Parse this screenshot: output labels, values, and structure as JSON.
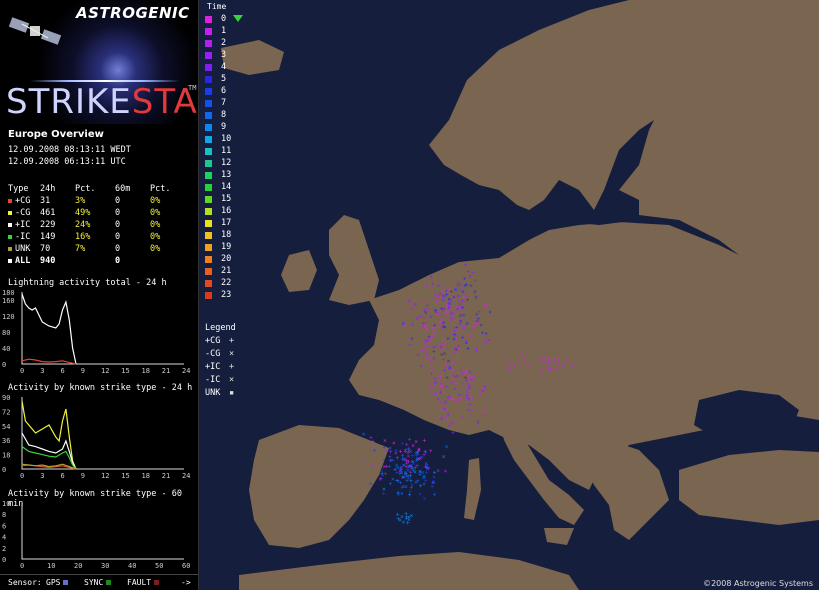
{
  "logo": {
    "brand": "ASTROGENIC",
    "title_a": "STRIKE",
    "title_b": "STAR",
    "tm": "TM"
  },
  "overview": {
    "title": "Europe Overview",
    "time_local": "12.09.2008 08:13:11 WEDT",
    "time_utc": "12.09.2008 06:13:11 UTC"
  },
  "stats": {
    "headers": [
      "Type",
      "24h",
      "Pct.",
      "60m",
      "Pct."
    ],
    "rows": [
      {
        "type": "+CG",
        "h24": "31",
        "pct24": "3%",
        "m60": "0",
        "pct60": "0%",
        "color": "#e04a2a"
      },
      {
        "type": "-CG",
        "h24": "461",
        "pct24": "49%",
        "m60": "0",
        "pct60": "0%",
        "color": "#f2f23a"
      },
      {
        "type": "+IC",
        "h24": "229",
        "pct24": "24%",
        "m60": "0",
        "pct60": "0%",
        "color": "#ffffff"
      },
      {
        "type": "-IC",
        "h24": "149",
        "pct24": "16%",
        "m60": "0",
        "pct60": "0%",
        "color": "#3ad23a"
      },
      {
        "type": "UNK",
        "h24": "70",
        "pct24": "7%",
        "m60": "0",
        "pct60": "0%",
        "color": "#b0a030"
      }
    ],
    "all": {
      "type": "ALL",
      "h24": "940",
      "m60": "0"
    }
  },
  "graphs": {
    "total_title": "Lightning activity total - 24 h",
    "type24_title": "Activity by known strike type - 24 h",
    "type60_title": "Activity by known strike type - 60 min"
  },
  "chart_data": [
    {
      "type": "line",
      "title": "Lightning activity total - 24 h",
      "ylim": [
        0,
        180
      ],
      "yticks": [
        "180",
        "160",
        "120",
        "80",
        "40",
        "0"
      ],
      "yticks_values": [
        180,
        160,
        120,
        80,
        40,
        0
      ],
      "xlim": [
        0,
        24
      ],
      "xticks": [
        "0",
        "3",
        "6",
        "9",
        "12",
        "15",
        "18",
        "21",
        "24"
      ],
      "series": [
        {
          "color": "#ffffff",
          "x": [
            0,
            0.5,
            1,
            1.5,
            2,
            3,
            4,
            5,
            5.5,
            6,
            6.5,
            7,
            7.5,
            8
          ],
          "y": [
            175,
            150,
            140,
            135,
            140,
            105,
            95,
            90,
            100,
            135,
            155,
            110,
            40,
            0
          ]
        },
        {
          "color": "#e04a2a",
          "x": [
            0,
            1,
            2,
            3,
            4,
            5,
            6,
            7,
            8
          ],
          "y": [
            8,
            12,
            10,
            6,
            5,
            6,
            8,
            4,
            0
          ]
        }
      ]
    },
    {
      "type": "line",
      "title": "Activity by known strike type - 24 h",
      "ylim": [
        0,
        90
      ],
      "yticks": [
        "90",
        "72",
        "54",
        "36",
        "18",
        "0"
      ],
      "yticks_values": [
        90,
        72,
        54,
        36,
        18,
        0
      ],
      "xlim": [
        0,
        24
      ],
      "xticks": [
        "0",
        "3",
        "6",
        "9",
        "12",
        "15",
        "18",
        "21",
        "24"
      ],
      "series": [
        {
          "color": "#f2f23a",
          "x": [
            0,
            0.5,
            1,
            2,
            3,
            4,
            5,
            5.5,
            6,
            6.5,
            7,
            7.5,
            8
          ],
          "y": [
            85,
            60,
            55,
            45,
            50,
            55,
            40,
            35,
            60,
            75,
            40,
            10,
            0
          ]
        },
        {
          "color": "#ffffff",
          "x": [
            0,
            1,
            2,
            3,
            4,
            5,
            6,
            6.5,
            7,
            7.5,
            8
          ],
          "y": [
            45,
            30,
            28,
            25,
            22,
            20,
            25,
            35,
            22,
            8,
            0
          ]
        },
        {
          "color": "#3ad23a",
          "x": [
            0,
            1,
            2,
            3,
            4,
            5,
            6,
            6.5,
            7,
            7.5,
            8
          ],
          "y": [
            28,
            22,
            20,
            18,
            16,
            15,
            20,
            22,
            14,
            5,
            0
          ]
        },
        {
          "color": "#e04a2a",
          "x": [
            0,
            1,
            2,
            3,
            4,
            5,
            6,
            7,
            8
          ],
          "y": [
            4,
            5,
            4,
            3,
            2,
            3,
            4,
            2,
            0
          ]
        },
        {
          "color": "#b0a030",
          "x": [
            0,
            1,
            2,
            3,
            4,
            5,
            6,
            7,
            8
          ],
          "y": [
            6,
            5,
            4,
            5,
            3,
            4,
            6,
            3,
            0
          ]
        }
      ]
    },
    {
      "type": "line",
      "title": "Activity by known strike type - 60 min",
      "ylim": [
        0,
        10
      ],
      "yticks": [
        "10",
        "8",
        "6",
        "4",
        "2",
        "0"
      ],
      "yticks_values": [
        10,
        8,
        6,
        4,
        2,
        0
      ],
      "xlim": [
        0,
        60
      ],
      "xticks": [
        "0",
        "10",
        "20",
        "30",
        "40",
        "50",
        "60"
      ],
      "series": []
    }
  ],
  "sensor": {
    "label": "Sensor:",
    "gps": "GPS",
    "sync": "SYNC",
    "fault": "FAULT",
    "arrow": "->",
    "gps_color": "#6a6ad0",
    "sync_color": "#1f8a1f",
    "fault_color": "#7a1f1f"
  },
  "legend": {
    "time_title": "Time",
    "time_colors": [
      "#e020e0",
      "#c820e8",
      "#b020ee",
      "#9820f0",
      "#8020f0",
      "#2828e0",
      "#1c3ce6",
      "#1650ea",
      "#1068ee",
      "#0c88f0",
      "#10a8e8",
      "#18c0c0",
      "#1cc890",
      "#20d060",
      "#28d03a",
      "#60d828",
      "#b0e020",
      "#e8e020",
      "#f0c020",
      "#f0a020",
      "#f08020",
      "#e86020",
      "#e04a20",
      "#d83a20"
    ],
    "time_labels": [
      "0",
      "1",
      "2",
      "3",
      "4",
      "5",
      "6",
      "7",
      "8",
      "9",
      "10",
      "11",
      "12",
      "13",
      "14",
      "15",
      "16",
      "17",
      "18",
      "19",
      "20",
      "21",
      "22",
      "23"
    ],
    "type_title": "Legend",
    "types": [
      {
        "label": "+CG",
        "sym": "+"
      },
      {
        "label": "-CG",
        "sym": "×"
      },
      {
        "label": "+IC",
        "sym": "+"
      },
      {
        "label": "-IC",
        "sym": "×"
      },
      {
        "label": "UNK",
        "sym": "▪"
      }
    ]
  },
  "map": {
    "copyright": "©2008 Astrogenic Systems",
    "ocean": "#161e3e",
    "land": "#7a6650",
    "border": "#a8967c"
  }
}
